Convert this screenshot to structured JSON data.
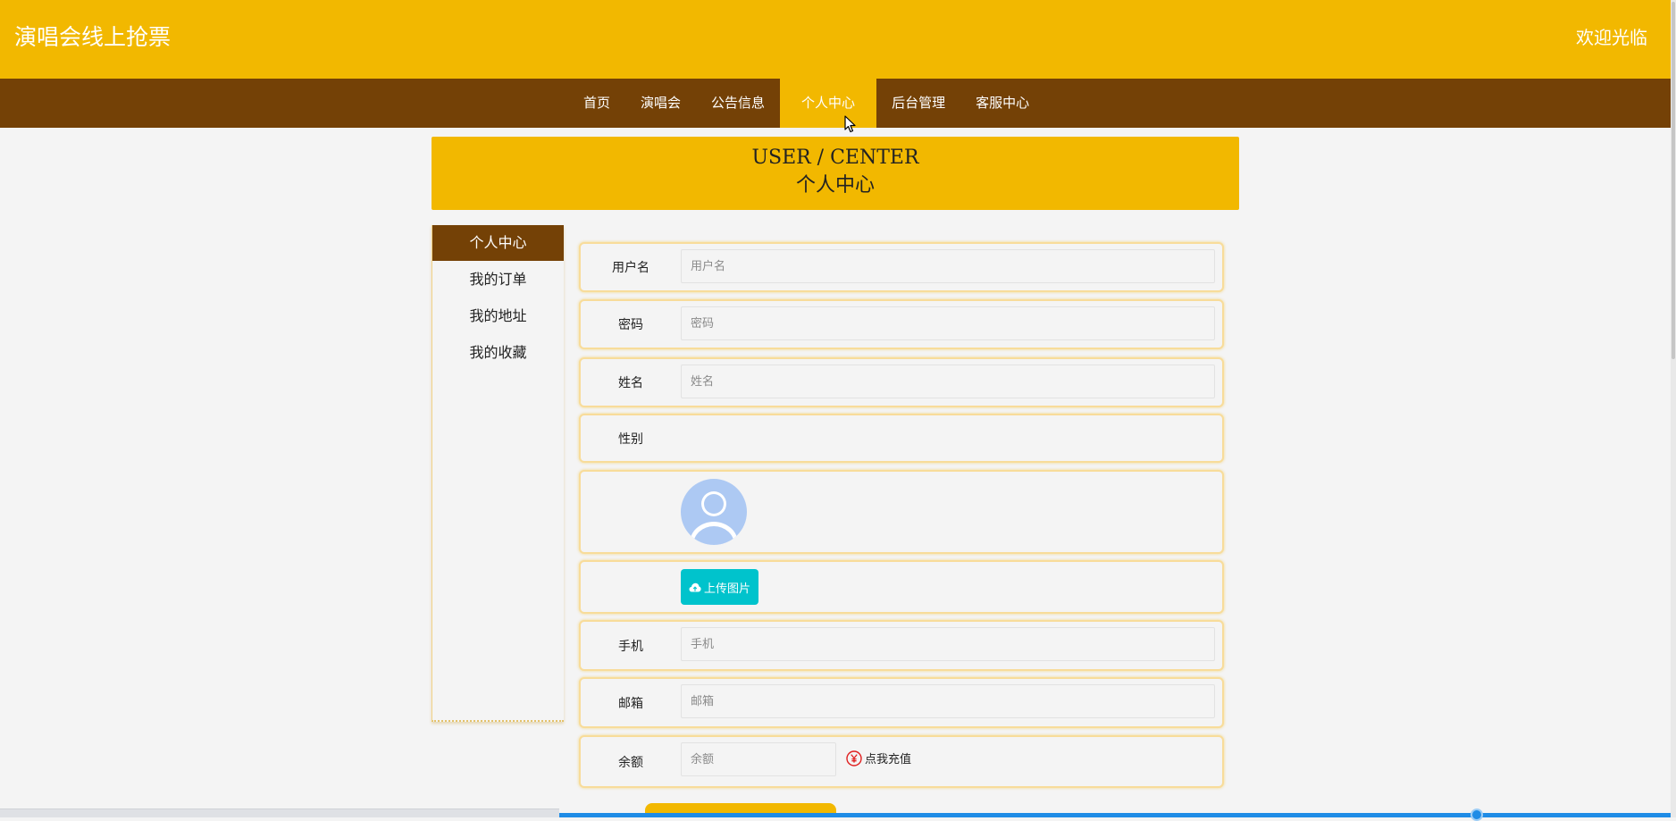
{
  "header": {
    "site_title": "演唱会线上抢票",
    "welcome": "欢迎光临"
  },
  "nav": {
    "items": [
      {
        "label": "首页"
      },
      {
        "label": "演唱会"
      },
      {
        "label": "公告信息"
      },
      {
        "label": "个人中心",
        "active": true
      },
      {
        "label": "后台管理"
      },
      {
        "label": "客服中心"
      }
    ]
  },
  "banner": {
    "en": "USER / CENTER",
    "cn": "个人中心"
  },
  "sidebar": {
    "items": [
      {
        "label": "个人中心",
        "active": true
      },
      {
        "label": "我的订单"
      },
      {
        "label": "我的地址"
      },
      {
        "label": "我的收藏"
      }
    ]
  },
  "form": {
    "username": {
      "label": "用户名",
      "placeholder": "用户名",
      "value": ""
    },
    "password": {
      "label": "密码",
      "placeholder": "密码",
      "value": ""
    },
    "name": {
      "label": "姓名",
      "placeholder": "姓名",
      "value": ""
    },
    "gender": {
      "label": "性别"
    },
    "upload_label": "上传图片",
    "phone": {
      "label": "手机",
      "placeholder": "手机",
      "value": ""
    },
    "email": {
      "label": "邮箱",
      "placeholder": "邮箱",
      "value": ""
    },
    "balance": {
      "label": "余额",
      "placeholder": "余额",
      "value": ""
    },
    "recharge_label": "点我充值"
  },
  "icons": {
    "avatar": "default-avatar-icon",
    "upload": "cloud-upload-icon",
    "recharge": "yen-icon",
    "cursor": "mouse-cursor-icon"
  },
  "colors": {
    "primary": "#f2b800",
    "dark": "#744106",
    "upload_button": "#00c3cc",
    "recharge_icon": "#e02020",
    "avatar": "#adc9f3"
  }
}
